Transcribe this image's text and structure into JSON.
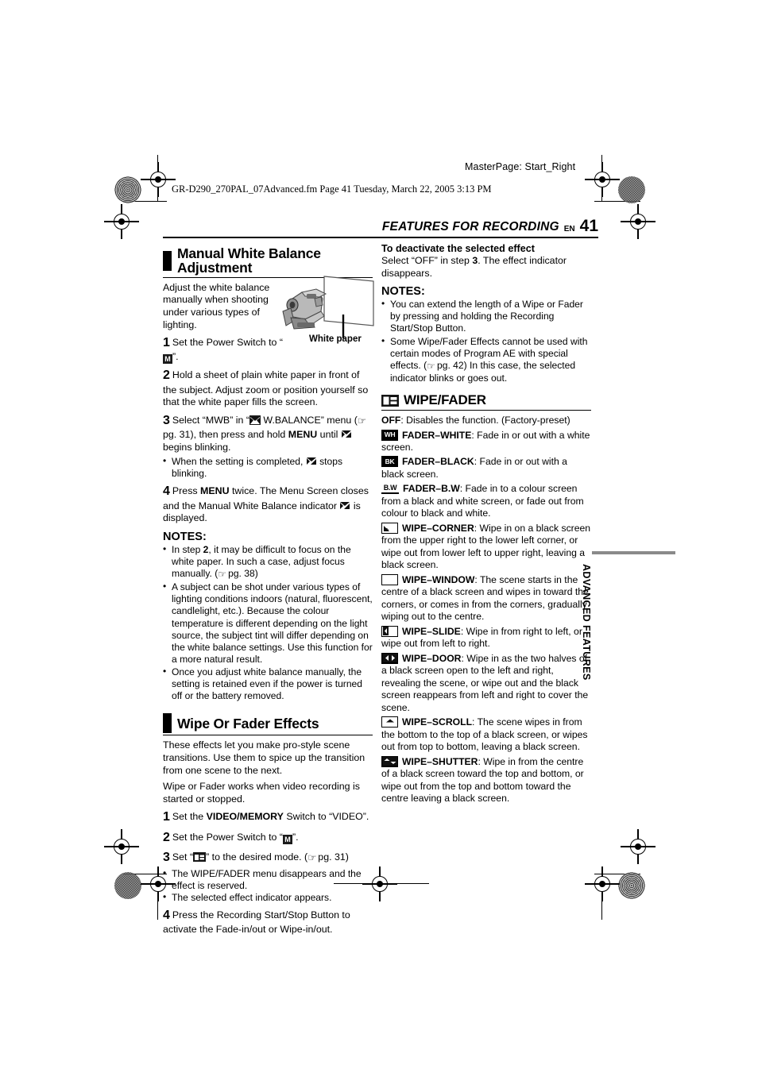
{
  "page_marks": {
    "masterpage": "MasterPage: Start_Right",
    "file_line": "GR-D290_270PAL_07Advanced.fm  Page 41  Tuesday, March 22, 2005  3:13 PM"
  },
  "running_head": {
    "title": "FEATURES FOR RECORDING",
    "lang": "EN",
    "page_number": "41"
  },
  "side_tab": {
    "label": "ADVANCED FEATURES"
  },
  "left_column": {
    "section1": {
      "heading": "Manual White Balance Adjustment",
      "intro": "Adjust the white balance manually when shooting under various types of lighting.",
      "illustration": {
        "caption": "White paper",
        "alt": "camcorder-and-white-paper"
      },
      "steps": [
        {
          "n": "1",
          "text_a": "Set the Power Switch to “",
          "icon": "M",
          "text_b": "”."
        },
        {
          "n": "2",
          "text": "Hold a sheet of plain white paper in front of the subject. Adjust zoom or position yourself so that the white paper fills the screen."
        },
        {
          "n": "3",
          "text_a": "Select “MWB” in “",
          "icon": "wb",
          "text_b": " W.BALANCE” menu (",
          "ref": "pg. 31",
          "text_c": "), then press and hold ",
          "bold": "MENU",
          "text_d": " until ",
          "text_e": " begins blinking."
        },
        {
          "n": "4",
          "text_a": "Press ",
          "bold": "MENU",
          "text_b": " twice. The Menu Screen closes and the Manual White Balance indicator ",
          "text_c": " is displayed."
        }
      ],
      "step3_bullet": "When the setting is completed,  stops blinking.",
      "notes_heading": "NOTES:",
      "notes": [
        "In step 2, it may be difficult to focus on the white paper. In such a case, adjust focus manually. ( pg. 38)",
        "A subject can be shot under various types of lighting conditions indoors (natural, fluorescent, candlelight, etc.). Because the colour temperature is different depending on the light source, the subject tint will differ depending on the white balance settings. Use this function for a more natural result.",
        "Once you adjust white balance manually, the setting is retained even if the power is turned off or the battery removed."
      ],
      "notes_step_ref": "2",
      "notes_pg_ref": "pg. 38"
    },
    "section2": {
      "heading": "Wipe Or Fader Effects",
      "intro1": "These effects let you make pro-style scene transitions. Use them to spice up the transition from one scene to the next.",
      "intro2": "Wipe or Fader works when video recording is started or stopped.",
      "steps": [
        {
          "n": "1",
          "text_a": "Set the ",
          "bold": "VIDEO/MEMORY",
          "text_b": " Switch to “VIDEO”."
        },
        {
          "n": "2",
          "text_a": "Set the Power Switch to “",
          "icon": "M",
          "text_b": "”."
        },
        {
          "n": "3",
          "text_a": "Set “",
          "icon": "wf",
          "text_b": "” to the desired mode. (",
          "ref": "pg. 31",
          "text_c": ")"
        },
        {
          "n": "4",
          "text": "Press the Recording Start/Stop Button to activate the Fade-in/out or Wipe-in/out."
        }
      ],
      "step3_bullets": [
        "The WIPE/FADER menu disappears and the effect is reserved.",
        "The selected effect indicator appears."
      ]
    }
  },
  "right_column": {
    "deactivate": {
      "heading": "To deactivate the selected effect",
      "text_a": "Select “OFF” in step ",
      "step": "3",
      "text_b": ". The effect indicator disappears."
    },
    "notes_heading": "NOTES:",
    "notes": [
      "You can extend the length of a Wipe or Fader by pressing and holding the Recording Start/Stop Button.",
      "Some Wipe/Fader Effects cannot be used with certain modes of Program AE with special effects. ( pg. 42) In this case, the selected indicator blinks or goes out."
    ],
    "notes_pg_ref": "pg. 42",
    "wipe_fader": {
      "heading": "WIPE/FADER",
      "icon_name": "wipe-fader-menu-icon",
      "off": {
        "label": "OFF",
        "desc": ": Disables the function. (Factory-preset)"
      },
      "items": [
        {
          "icon": "WH",
          "icon_style": "solid",
          "label": "FADER–WHITE",
          "desc": ": Fade in or out with a white screen."
        },
        {
          "icon": "BK",
          "icon_style": "solid",
          "label": "FADER–BLACK",
          "desc": ": Fade in or out with a black screen."
        },
        {
          "icon": "B.W",
          "icon_style": "bw",
          "label": "FADER–B.W",
          "desc": ": Fade in to a colour screen from a black and white screen, or fade out from colour to black and white."
        },
        {
          "icon": "corner",
          "icon_style": "shape",
          "label": "WIPE–CORNER",
          "desc": ": Wipe in on a black screen from the upper right to the lower left corner, or wipe out from lower left to upper right, leaving a black screen."
        },
        {
          "icon": "window",
          "icon_style": "shape",
          "label": "WIPE–WINDOW",
          "desc": ": The scene starts in the centre of a black screen and wipes in toward the corners, or comes in from the corners, gradually wiping out to the centre."
        },
        {
          "icon": "slide",
          "icon_style": "shape",
          "label": "WIPE–SLIDE",
          "desc": ": Wipe in from right to left, or wipe out from left to right."
        },
        {
          "icon": "door",
          "icon_style": "shape",
          "label": "WIPE–DOOR",
          "desc": ": Wipe in as the two halves of a black screen open to the left and right, revealing the scene, or wipe out and the black screen reappears from left and right to cover the scene."
        },
        {
          "icon": "scroll",
          "icon_style": "shape",
          "label": "WIPE–SCROLL",
          "desc": ": The scene wipes in from the bottom to the top of a black screen, or wipes out from top to bottom, leaving a black screen."
        },
        {
          "icon": "shutter",
          "icon_style": "shape",
          "label": "WIPE–SHUTTER",
          "desc": ": Wipe in from the centre of a black screen toward the top and bottom, or wipe out from the top and bottom toward the centre leaving a black screen."
        }
      ]
    }
  }
}
